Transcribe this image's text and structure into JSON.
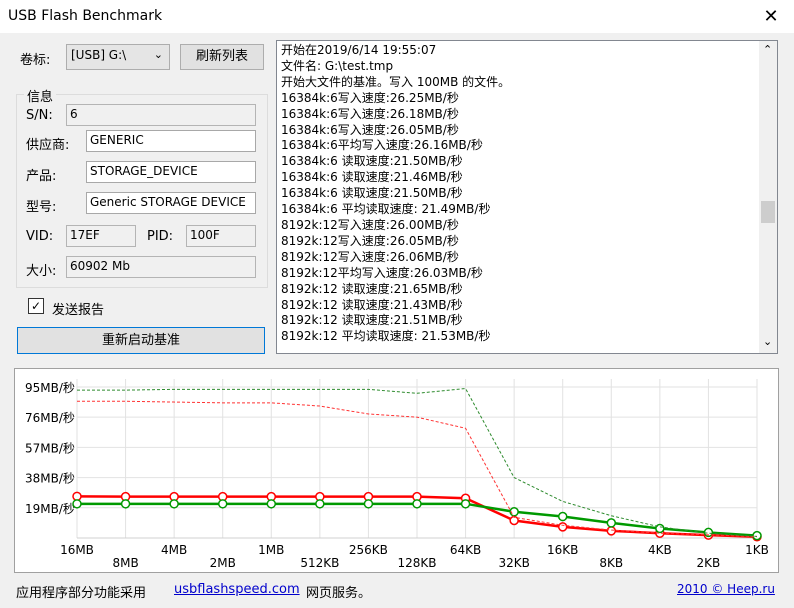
{
  "window": {
    "title": "USB Flash Benchmark",
    "close_glyph": "✕"
  },
  "volume": {
    "label": "卷标:",
    "selected": "[USB] G:\\",
    "refresh_button": "刷新列表"
  },
  "info": {
    "group_title": "信息",
    "sn_label": "S/N:",
    "sn_value": "6",
    "vendor_label": "供应商:",
    "vendor_value": "GENERIC",
    "product_label": "产品:",
    "product_value": "STORAGE_DEVICE",
    "model_label": "型号:",
    "model_value": "Generic STORAGE DEVICE",
    "vid_label": "VID:",
    "vid_value": "17EF",
    "pid_label": "PID:",
    "pid_value": "100F",
    "size_label": "大小:",
    "size_value": "60902 Mb"
  },
  "send_report": {
    "label": "发送报告",
    "checked": true
  },
  "restart_button": "重新启动基准",
  "log_lines": [
    "开始在2019/6/14 19:55:07",
    "文件名: G:\\test.tmp",
    "开始大文件的基准。写入 100MB 的文件。",
    "16384k:6写入速度:26.25MB/秒",
    "16384k:6写入速度:26.18MB/秒",
    "16384k:6写入速度:26.05MB/秒",
    "16384k:6平均写入速度:26.16MB/秒",
    "16384k:6 读取速度:21.50MB/秒",
    "16384k:6 读取速度:21.46MB/秒",
    "16384k:6 读取速度:21.50MB/秒",
    "16384k:6 平均读取速度: 21.49MB/秒",
    "8192k:12写入速度:26.00MB/秒",
    "8192k:12写入速度:26.05MB/秒",
    "8192k:12写入速度:26.06MB/秒",
    "8192k:12平均写入速度:26.03MB/秒",
    "8192k:12 读取速度:21.65MB/秒",
    "8192k:12 读取速度:21.43MB/秒",
    "8192k:12 读取速度:21.51MB/秒",
    "8192k:12 平均读取速度: 21.53MB/秒"
  ],
  "chart_data": {
    "type": "line",
    "ylim": [
      0,
      100
    ],
    "yticks": [
      {
        "value": 95,
        "label": "95MB/秒"
      },
      {
        "value": 76,
        "label": "76MB/秒"
      },
      {
        "value": 57,
        "label": "57MB/秒"
      },
      {
        "value": 38,
        "label": "38MB/秒"
      },
      {
        "value": 19,
        "label": "19MB/秒"
      }
    ],
    "categories": [
      "16MB",
      "8MB",
      "4MB",
      "2MB",
      "1MB",
      "512KB",
      "256KB",
      "128KB",
      "64KB",
      "32KB",
      "16KB",
      "8KB",
      "4KB",
      "2KB",
      "1KB"
    ],
    "series": [
      {
        "style": "solid-red",
        "color": "#ff0000",
        "values": [
          26.2,
          26.0,
          26.0,
          26.0,
          26.0,
          26.0,
          26.0,
          26.0,
          25.0,
          11.0,
          7.0,
          4.5,
          3.0,
          1.8,
          0.8
        ]
      },
      {
        "style": "solid-green",
        "color": "#009900",
        "values": [
          21.5,
          21.5,
          21.5,
          21.5,
          21.5,
          21.5,
          21.5,
          21.5,
          21.5,
          16.5,
          13.5,
          9.5,
          6.0,
          3.5,
          1.5
        ]
      },
      {
        "style": "dashed-red",
        "color": "#ff3333",
        "values": [
          86,
          86,
          85.5,
          85,
          85,
          83,
          78,
          76,
          69,
          13,
          8,
          5,
          3,
          2,
          0.8
        ]
      },
      {
        "style": "dashed-green",
        "color": "#2e8b2e",
        "values": [
          93,
          93,
          93.5,
          93.5,
          93.5,
          93.5,
          93.5,
          91,
          94,
          38,
          23,
          14,
          7,
          3,
          1
        ]
      }
    ]
  },
  "footer": {
    "text_before": "应用程序部分功能采用",
    "link": "usbflashspeed.com",
    "text_after": "网页服务。",
    "copyright": "2010 © Heep.ru"
  }
}
